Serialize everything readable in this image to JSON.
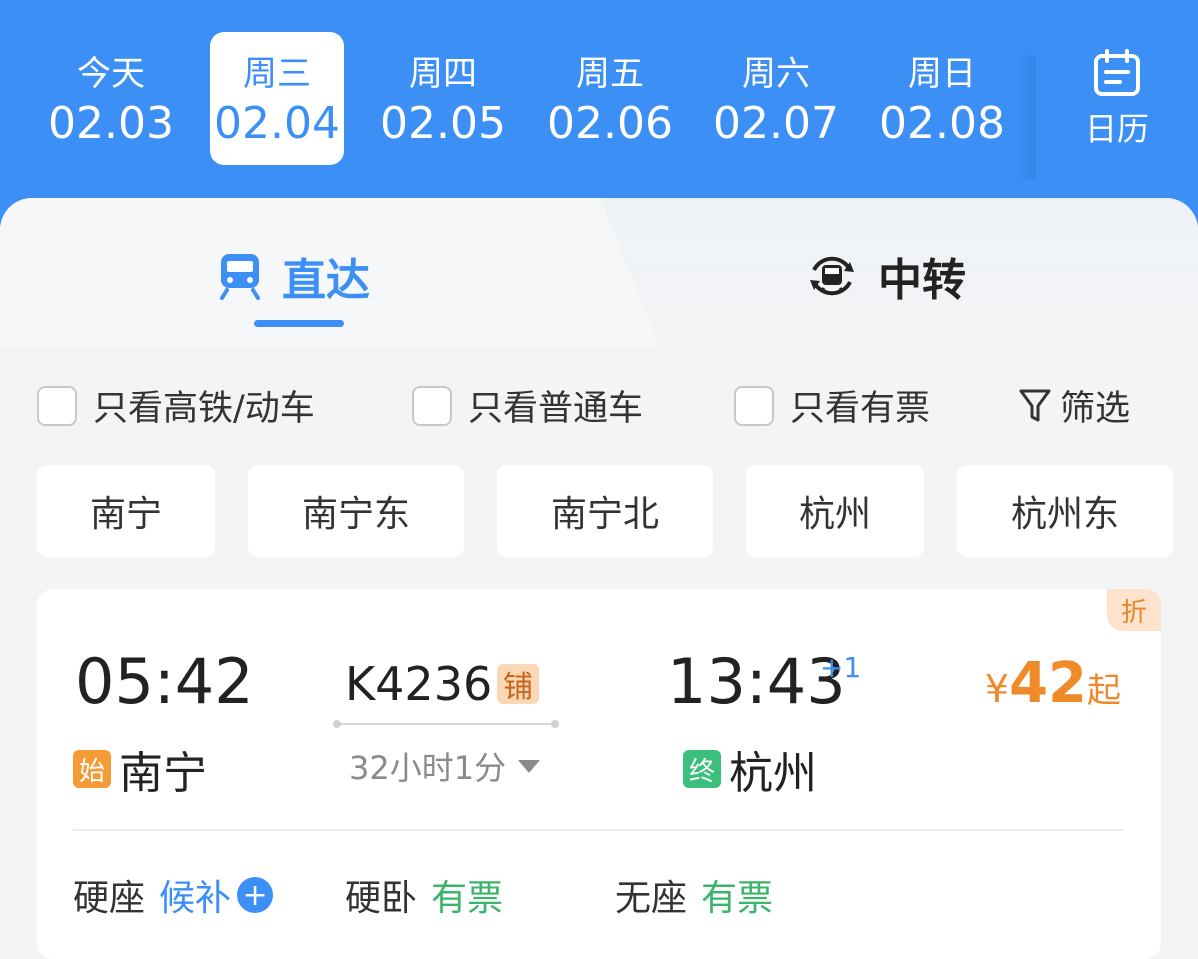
{
  "dates": [
    {
      "weekday": "今天",
      "date": "02.03"
    },
    {
      "weekday": "周三",
      "date": "02.04"
    },
    {
      "weekday": "周四",
      "date": "02.05"
    },
    {
      "weekday": "周五",
      "date": "02.06"
    },
    {
      "weekday": "周六",
      "date": "02.07"
    },
    {
      "weekday": "周日",
      "date": "02.08"
    }
  ],
  "calendar_label": "日历",
  "tabs": {
    "direct": "直达",
    "transfer": "中转"
  },
  "filters": {
    "high_speed": "只看高铁/动车",
    "normal": "只看普通车",
    "available": "只看有票",
    "filter_button": "筛选"
  },
  "stations": [
    "南宁",
    "南宁东",
    "南宁北",
    "杭州",
    "杭州东"
  ],
  "train": {
    "discount_tag": "折",
    "departure_time": "05:42",
    "train_number": "K4236",
    "sleeper_badge": "铺",
    "duration": "32小时1分",
    "arrival_time": "13:43",
    "plus_day": "+1",
    "price_currency": "¥",
    "price_value": "42",
    "price_suffix": "起",
    "departure_tag": "始",
    "departure_station": "南宁",
    "arrival_tag": "终",
    "arrival_station": "杭州",
    "seats": [
      {
        "type": "硬座",
        "status": "候补"
      },
      {
        "type": "硬卧",
        "status": "有票"
      },
      {
        "type": "无座",
        "status": "有票"
      }
    ]
  },
  "colors": {
    "accent": "#3b8ff5",
    "price": "#ef8a2a",
    "available": "#3bb56a"
  }
}
